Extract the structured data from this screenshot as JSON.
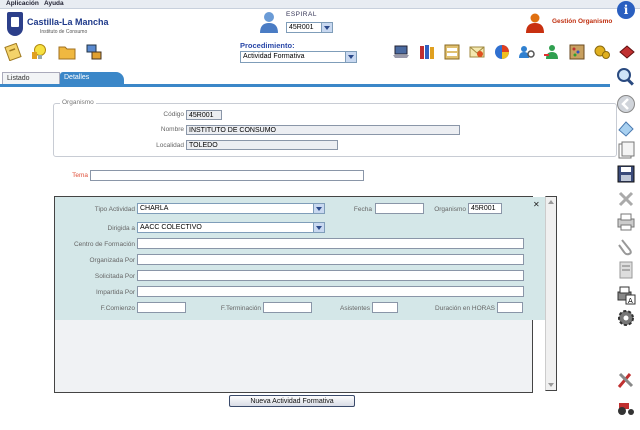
{
  "menu": {
    "app": "Aplicación",
    "help": "Ayuda"
  },
  "brand": {
    "title": "Castilla-La Mancha",
    "subtitle": "Instituto de Consumo"
  },
  "espiral": {
    "label": "ESPIRAL",
    "selected": "45R001"
  },
  "gestion": {
    "label": "Gestión Organismo"
  },
  "procedimiento": {
    "label": "Procedimiento:",
    "selected": "Actividad Formativa"
  },
  "tabs": [
    {
      "label": "Listado"
    },
    {
      "label": "Detalles"
    }
  ],
  "organismo": {
    "legend": "Organismo",
    "codigo_label": "Código",
    "codigo": "45R001",
    "nombre_label": "Nombre",
    "nombre": "INSTITUTO DE CONSUMO",
    "localidad_label": "Localidad",
    "localidad": "TOLEDO"
  },
  "tema": {
    "label": "Tema",
    "value": ""
  },
  "actividad": {
    "tipo_label": "Tipo Actividad",
    "tipo": "CHARLA",
    "fecha_label": "Fecha",
    "fecha": "",
    "organismo_label": "Organismo",
    "organismo": "45R001",
    "dirigida_label": "Dirigida a",
    "dirigida": "AACC COLECTIVO",
    "centro_label": "Centro de Formación",
    "centro": "",
    "organizada_label": "Organizada Por",
    "organizada": "",
    "solicitada_label": "Solicitada Por",
    "solicitada": "",
    "impartida_label": "Impartida Por",
    "impartida": "",
    "comienzo_label": "F.Comienzo",
    "comienzo": "",
    "terminacion_label": "F.Terminación",
    "terminacion": "",
    "asistentes_label": "Asistentes",
    "asistentes": "",
    "duracion_label": "Duración en HORAS",
    "duracion": "",
    "close": "✕"
  },
  "new_button": "Nueva Actividad Formativa",
  "colors": {
    "accent": "#3b87c8",
    "form_bg": "#d4e7e8",
    "title_blue": "#2a48a8",
    "tema_label": "#e0503a"
  }
}
